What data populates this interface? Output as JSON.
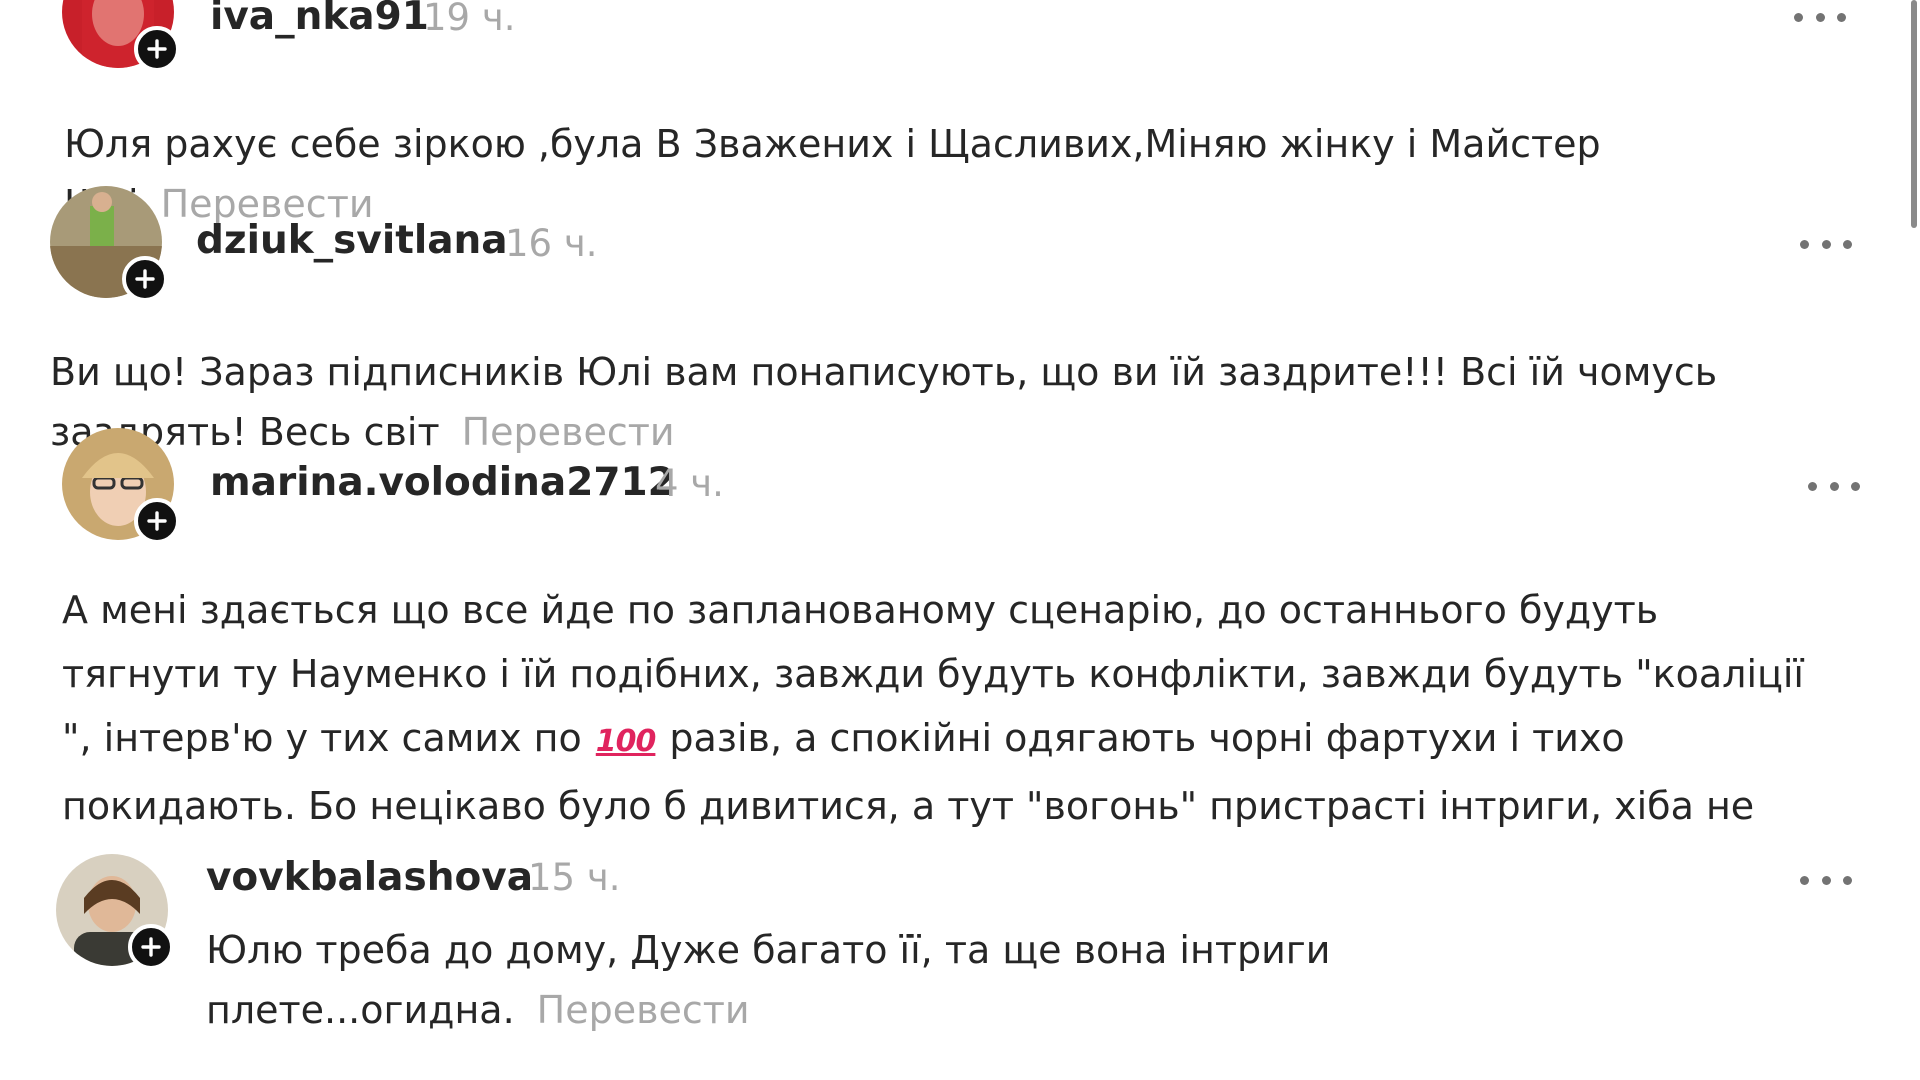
{
  "translate_label": "Перевести",
  "comments": [
    {
      "username": "iva_nka91",
      "time": "19 ч.",
      "text_lines": [
        "Юля рахує себе зіркою ,була В Зважених і Щасливих,Міняю жінку і Майстер",
        "Шеі"
      ],
      "avatar_color": "#c8202a"
    },
    {
      "username": "dziuk_svitlana",
      "time": "16 ч.",
      "text_lines": [
        "Ви що! Зараз підписників Юлі вам понаписують, що ви їй заздрите!!! Всі їй чомусь",
        "заздрять! Весь світ"
      ],
      "avatar_color": "#9b8a6a"
    },
    {
      "username": "marina.volodina2712",
      "time": "4 ч.",
      "text_lines": [
        "А мені здається що все йде по запланованому сценарію, до останнього будуть",
        "тягнути ту Науменко і їй подібних, завжди будуть конфлікти, завжди будуть \"коаліції",
        "\", інтерв'ю у тих самих по",
        "разів, а спокійні одягають чорні фартухи і тихо",
        "покидають. Бо нецікаво було б дивитися, а тут \"вогонь\" пристрасті інтриги, хіба не"
      ],
      "emoji": "100",
      "avatar_color": "#d9b98a"
    },
    {
      "username": "vovkbalashova",
      "time": "15 ч.",
      "text_lines": [
        "Юлю треба до дому, Дуже багато її, та ще вона інтриги",
        "плете...огидна."
      ],
      "avatar_color": "#6b5a3e"
    }
  ]
}
